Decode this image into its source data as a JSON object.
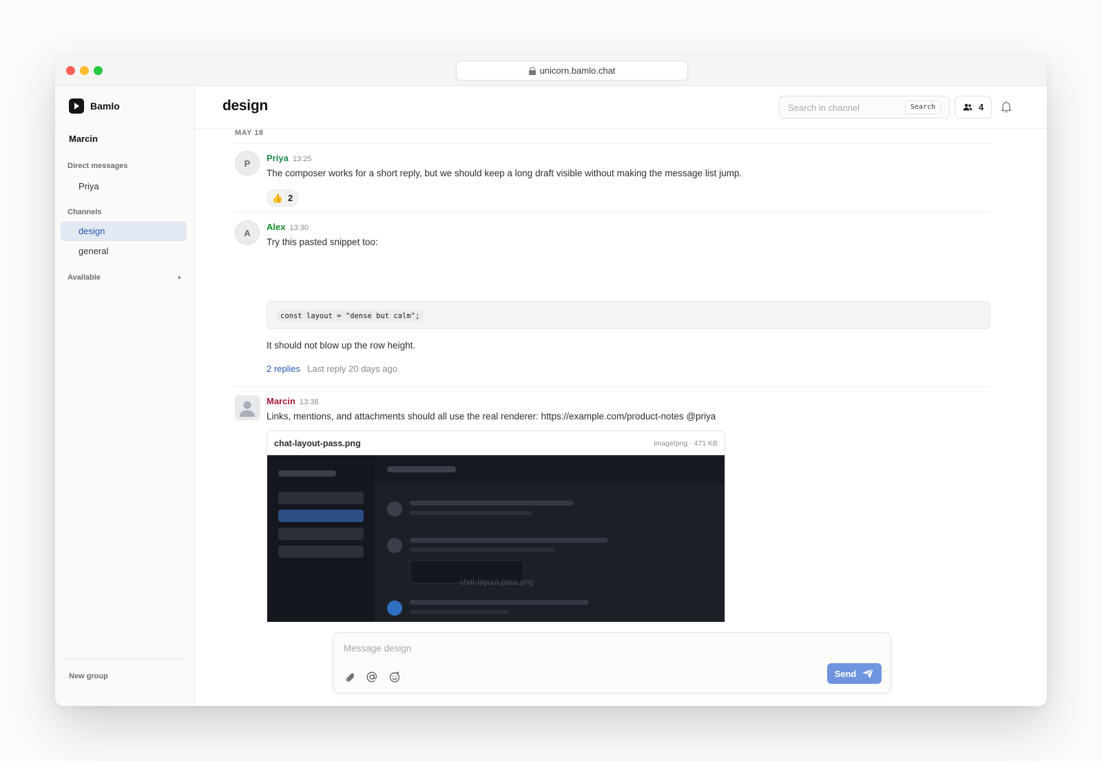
{
  "browser": {
    "url": "unicorn.bamlo.chat"
  },
  "sidebar": {
    "brand": "Bamlo",
    "user": "Marcin",
    "direct_messages_label": "Direct messages",
    "direct_messages": [
      "Priya"
    ],
    "channels_label": "Channels",
    "channels": [
      "design",
      "general"
    ],
    "active_channel": "design",
    "status": "Available",
    "new_group": "New group"
  },
  "header": {
    "channel": "design",
    "search_placeholder": "Search in channel",
    "search_button": "Search",
    "member_count": "4"
  },
  "messages": {
    "date": "MAY 18",
    "items": [
      {
        "author": "Priya",
        "author_color": "#1f8a4a",
        "avatar": "P",
        "time": "13:25",
        "text": "The composer works for a short reply, but we should keep a long draft visible without making the message list jump.",
        "reaction_emoji": "👍",
        "reaction_count": "2"
      },
      {
        "author": "Alex",
        "author_color": "#178a2a",
        "avatar": "A",
        "time": "13:30",
        "text": "Try this pasted snippet too:",
        "code": "const layout = \"dense but calm\";",
        "text_after": "It should not blow up the row height.",
        "replies": "2 replies",
        "last_reply": "Last reply 20 days ago"
      },
      {
        "author": "Marcin",
        "author_color": "#a3163a",
        "time": "13:38",
        "text": "Links, mentions, and attachments should all use the real renderer: https://example.com/product-notes @priya",
        "attachment": {
          "name": "chat-layout-pass.png",
          "meta": "image/png · 471 KB",
          "caption": "chat-layout-pass.png"
        }
      }
    ]
  },
  "composer": {
    "placeholder": "Message design",
    "send_label": "Send",
    "icons": [
      "paperclip-icon",
      "at-icon",
      "emoji-icon"
    ]
  },
  "colors": {
    "accent": "#2456b4",
    "send": "#6f95e0",
    "active_item_bg": "#e3e9f2"
  }
}
